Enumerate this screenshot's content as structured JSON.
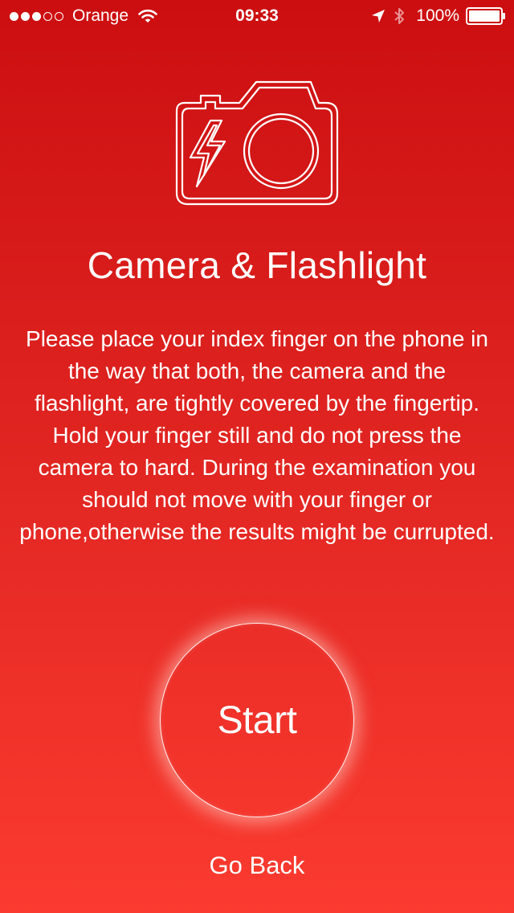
{
  "status_bar": {
    "carrier": "Orange",
    "time": "09:33",
    "battery": "100%",
    "signal_bars_filled": 3,
    "signal_bars_total": 5,
    "icons": [
      "wifi-icon",
      "location-arrow-icon",
      "bluetooth-icon",
      "battery-icon"
    ]
  },
  "screen": {
    "icon": "camera-flash-icon",
    "title": "Camera & Flashlight",
    "instructions": "Please place your index finger on the phone in the way that both, the camera and the flashlight, are tightly covered by the fingertip. Hold your finger still and do not press the camera to hard. During the examination you should not move with your finger or phone,otherwise the results might be currupted.",
    "start_label": "Start",
    "go_back_label": "Go Back"
  },
  "colors": {
    "background_top": "#cc0e10",
    "background_bottom": "#fb3b30",
    "foreground": "#ffffff"
  }
}
